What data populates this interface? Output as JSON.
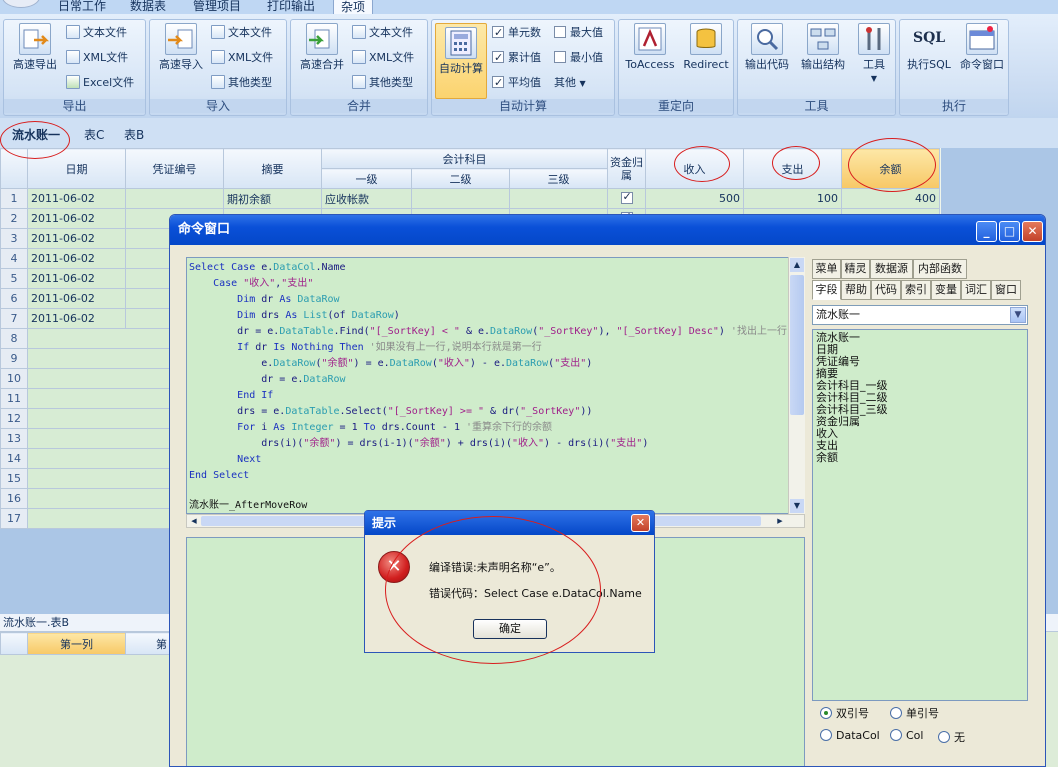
{
  "menu": {
    "tabs": [
      "日常工作",
      "数据表",
      "管理项目",
      "打印输出",
      "杂项"
    ],
    "active_index": 4
  },
  "ribbon": {
    "groups": [
      {
        "title": "导出",
        "big": "高速导出",
        "small": [
          "文本文件",
          "XML文件",
          "Excel文件"
        ]
      },
      {
        "title": "导入",
        "big": "高速导入",
        "small": [
          "文本文件",
          "XML文件",
          "其他类型"
        ]
      },
      {
        "title": "合并",
        "big": "高速合并",
        "small": [
          "文本文件",
          "XML文件",
          "其他类型"
        ]
      },
      {
        "title": "自动计算",
        "big": "自动计算",
        "checks": [
          {
            "label": "单元数",
            "on": true
          },
          {
            "label": "最大值",
            "on": false
          },
          {
            "label": "累计值",
            "on": true
          },
          {
            "label": "最小值",
            "on": false
          },
          {
            "label": "平均值",
            "on": true
          }
        ],
        "other": "其他"
      },
      {
        "title": "重定向",
        "buttons": [
          "ToAccess",
          "Redirect"
        ]
      },
      {
        "title": "工具",
        "buttons": [
          "输出代码",
          "输出结构",
          "工具"
        ]
      },
      {
        "title": "执行",
        "buttons": [
          "执行SQL",
          "命令窗口"
        ],
        "sql_icon": "SQL"
      }
    ]
  },
  "sheet_tabs": [
    "流水账一",
    "表C",
    "表B"
  ],
  "grid": {
    "headers": {
      "date": "日期",
      "voucher": "凭证编号",
      "summary": "摘要",
      "account": "会计科目",
      "level1": "一级",
      "level2": "二级",
      "level3": "三级",
      "fund": "资金归属",
      "income": "收入",
      "expense": "支出",
      "balance": "余额"
    },
    "row_numbers": [
      "1",
      "2",
      "3",
      "4",
      "5",
      "6",
      "7",
      "8",
      "9",
      "10",
      "11",
      "12",
      "13",
      "14",
      "15",
      "16",
      "17"
    ],
    "rows": [
      {
        "date": "2011-06-02",
        "summary": "期初余额",
        "level1": "应收帐款",
        "income": "500",
        "expense": "100",
        "balance": "400",
        "fund": true
      },
      {
        "date": "2011-06-02",
        "summary": "",
        "level1": "",
        "income": "",
        "expense": "",
        "balance": "",
        "fund": true
      },
      {
        "date": "2011-06-02"
      },
      {
        "date": "2011-06-02"
      },
      {
        "date": "2011-06-02"
      },
      {
        "date": "2011-06-02"
      },
      {
        "date": "2011-06-02"
      }
    ]
  },
  "second_table": {
    "title": "流水账一.表B",
    "col1": "第一列",
    "col2": "第"
  },
  "command_window": {
    "title": "命令窗口",
    "footer_line": "流水账一_AfterMoveRow",
    "side_tabs_row1": [
      "菜单",
      "精灵",
      "数据源",
      "内部函数"
    ],
    "side_tabs_row2": [
      "字段",
      "帮助",
      "代码",
      "索引",
      "变量",
      "词汇",
      "窗口"
    ],
    "combo_value": "流水账一",
    "fields": [
      "流水账一",
      "日期",
      "凭证编号",
      "摘要",
      "会计科目_一级",
      "会计科目_二级",
      "会计科目_三级",
      "资金归属",
      "收入",
      "支出",
      "余额"
    ],
    "radios": [
      {
        "label": "双引号",
        "on": true
      },
      {
        "label": "单引号",
        "on": false
      },
      {
        "label": "DataCol",
        "on": false
      },
      {
        "label": "Col",
        "on": false
      },
      {
        "label": "无",
        "on": false
      }
    ]
  },
  "dialog": {
    "title": "提示",
    "message": "编译错误:未声明名称“e”。",
    "code_line": "错误代码：Select Case e.DataCol.Name",
    "ok": "确定"
  }
}
